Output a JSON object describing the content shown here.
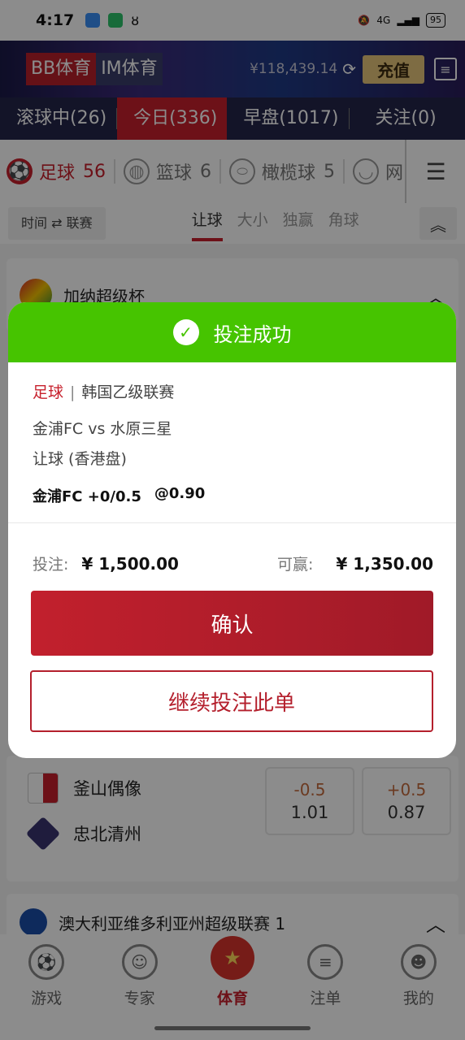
{
  "status_bar": {
    "time": "4:17",
    "battery": "95",
    "network": "4G"
  },
  "header": {
    "brand_tabs": [
      "BB体育",
      "IM体育"
    ],
    "balance": "¥118,439.14",
    "recharge_label": "充值"
  },
  "time_tabs": [
    {
      "label": "滚球中(26)"
    },
    {
      "label": "今日(336)"
    },
    {
      "label": "早盘(1017)"
    },
    {
      "label": "关注(0)"
    }
  ],
  "sports": [
    {
      "label": "足球",
      "count": "56"
    },
    {
      "label": "篮球",
      "count": "6"
    },
    {
      "label": "橄榄球",
      "count": "5"
    },
    {
      "label": "网",
      "count": ""
    }
  ],
  "sort_toggle": {
    "left": "时间",
    "right": "联赛"
  },
  "market_tabs": [
    "让球",
    "大小",
    "独赢",
    "角球"
  ],
  "leagues": [
    {
      "name": "加纳超级杯"
    },
    {
      "name": "澳大利亚维多利亚州超级联赛 1"
    }
  ],
  "match_bg": {
    "home": "釜山偶像",
    "away": "忠北清州",
    "odds": [
      {
        "line": "-0.5",
        "value": "1.01"
      },
      {
        "line": "+0.5",
        "value": "0.87"
      }
    ]
  },
  "bottom_nav": [
    {
      "label": "游戏"
    },
    {
      "label": "专家"
    },
    {
      "label": "体育"
    },
    {
      "label": "注单"
    },
    {
      "label": "我的"
    }
  ],
  "modal": {
    "title": "投注成功",
    "sport": "足球",
    "separator": "|",
    "league": "韩国乙级联赛",
    "match": "金浦FC vs 水原三星",
    "market": "让球 (香港盘)",
    "pick": "金浦FC +0/0.5",
    "odds": "@0.90",
    "stake_label": "投注:",
    "stake": "¥ 1,500.00",
    "win_label": "可赢:",
    "win": "¥ 1,350.00",
    "confirm_label": "确认",
    "continue_label": "继续投注此单"
  },
  "colors": {
    "accent": "#c7202c",
    "success": "#46c400",
    "odds_line": "#c46b3d"
  }
}
